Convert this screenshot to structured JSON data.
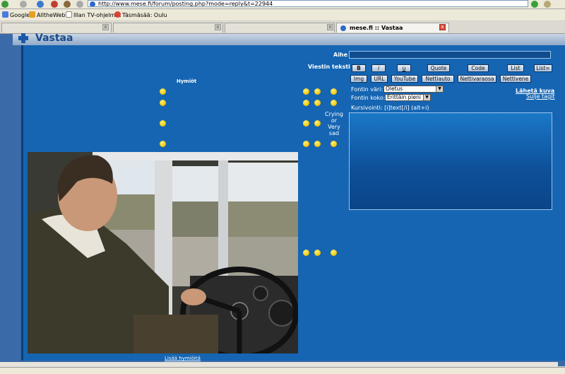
{
  "browser": {
    "url": "http://www.mese.fi/forum/posting.php?mode=reply&t=22944",
    "bookmarks": [
      "Google",
      "AlltheWeb",
      "Illan TV-ohjelmat",
      "Täsmäsää: Oulu"
    ],
    "active_tab": "mese.fi :: Vastaa"
  },
  "page": {
    "title": "Vastaa",
    "subject_label": "Aihe",
    "message_label": "Viestin teksti",
    "smilies_title": "Hymiöt",
    "smiley_text": [
      "Crying",
      "or",
      "Very",
      "sad"
    ],
    "bbcode_row1": [
      "B",
      "i",
      "u",
      "Quote",
      "Code",
      "List",
      "List="
    ],
    "bbcode_row2": [
      "Img",
      "URL",
      "YouTube",
      "Nettiauto",
      "Nettivaraosa",
      "Nettivene"
    ],
    "font_color_label": "Fontin väri:",
    "font_color_value": "Oletus",
    "font_size_label": "Fontin koko:",
    "font_size_value": "Erittäin pieni",
    "send_image": "Lähetä kuva",
    "close_tags": "Sulje tagit",
    "help_text": "Kursivointi: [i]text[/i]  (alt+i)",
    "more_smilies": "Lisää hymiöitä"
  },
  "colors": {
    "panel": "#1565b3",
    "accent": "#0c3f75"
  }
}
